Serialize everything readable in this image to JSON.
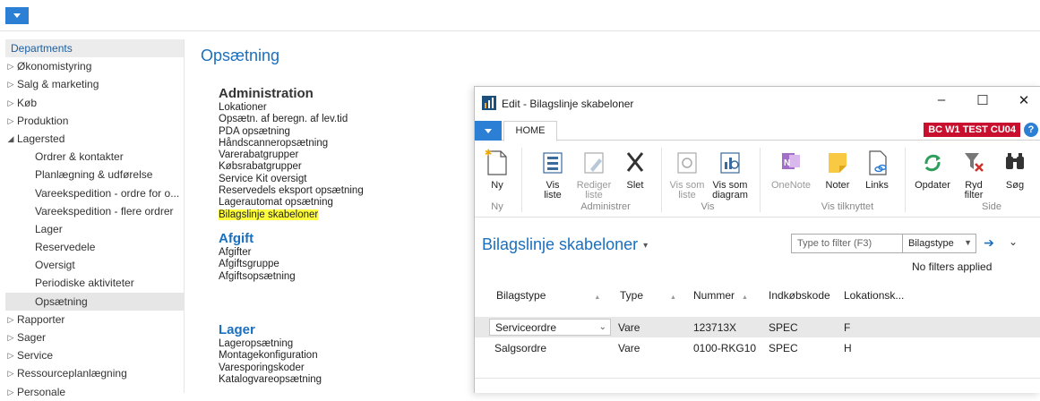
{
  "nav": {
    "root": "Departments",
    "items": [
      {
        "label": "Økonomistyring",
        "level": 0,
        "expanded": false
      },
      {
        "label": "Salg & marketing",
        "level": 0,
        "expanded": false
      },
      {
        "label": "Køb",
        "level": 0,
        "expanded": false
      },
      {
        "label": "Produktion",
        "level": 0,
        "expanded": false
      },
      {
        "label": "Lagersted",
        "level": 0,
        "expanded": true
      },
      {
        "label": "Ordrer & kontakter",
        "level": 1
      },
      {
        "label": "Planlægning & udførelse",
        "level": 1
      },
      {
        "label": "Vareekspedition - ordre for o...",
        "level": 1
      },
      {
        "label": "Vareekspedition - flere ordrer",
        "level": 1
      },
      {
        "label": "Lager",
        "level": 1
      },
      {
        "label": "Reservedele",
        "level": 1
      },
      {
        "label": "Oversigt",
        "level": 1
      },
      {
        "label": "Periodiske aktiviteter",
        "level": 1
      },
      {
        "label": "Opsætning",
        "level": 1,
        "selected": true
      },
      {
        "label": "Rapporter",
        "level": 0,
        "expanded": false
      },
      {
        "label": "Sager",
        "level": 0,
        "expanded": false
      },
      {
        "label": "Service",
        "level": 0,
        "expanded": false
      },
      {
        "label": "Ressourceplanlægning",
        "level": 0,
        "expanded": false
      },
      {
        "label": "Personale",
        "level": 0,
        "expanded": false
      }
    ]
  },
  "page": {
    "title": "Opsætning",
    "sections": [
      {
        "heading": "Administration",
        "style": "admin",
        "links": [
          "Lokationer",
          "Opsætn. af beregn. af lev.tid",
          "PDA opsætning",
          "Håndscanneropsætning",
          "Varerabatgrupper",
          "Købsrabatgrupper",
          "Service Kit oversigt",
          "Reservedels eksport opsætning",
          "Lagerautomat opsætning",
          "Bilagslinje skabeloner"
        ],
        "highlighted": "Bilagslinje skabeloner"
      },
      {
        "heading": "Afgift",
        "style": "blue",
        "links": [
          "Afgifter",
          "Afgiftsgruppe",
          "Afgiftsopsætning"
        ]
      },
      {
        "heading": "Lager",
        "style": "blue",
        "links": [
          "Lageropsætning",
          "Montagekonfiguration",
          "Varesporingskoder",
          "Katalogvareopsætning"
        ]
      }
    ]
  },
  "window": {
    "title": "Edit - Bilagslinje skabeloner",
    "tab": "HOME",
    "env_badge": "BC W1 TEST CU04",
    "help": "?",
    "ribbon": {
      "buttons": {
        "new": "Ny",
        "view_list_1": "Vis",
        "view_list_2": "liste",
        "edit_list_1": "Rediger",
        "edit_list_2": "liste",
        "delete": "Slet",
        "show_as_list_1": "Vis som",
        "show_as_list_2": "liste",
        "show_as_chart_1": "Vis som",
        "show_as_chart_2": "diagram",
        "onenote": "OneNote",
        "notes": "Noter",
        "links": "Links",
        "refresh": "Opdater",
        "clear_filter_1": "Ryd",
        "clear_filter_2": "filter",
        "search": "Søg"
      },
      "groups": {
        "new": "Ny",
        "manage": "Administrer",
        "view": "Vis",
        "attached": "Vis tilknyttet",
        "page": "Side"
      }
    },
    "list": {
      "title": "Bilagslinje skabeloner",
      "filter_placeholder": "Type to filter (F3)",
      "filter_field": "Bilagstype",
      "filter_status": "No filters applied",
      "columns": [
        "Bilagstype",
        "Type",
        "Nummer",
        "Indkøbskode",
        "Lokationsk..."
      ],
      "rows": [
        {
          "bilagstype": "Serviceordre",
          "type": "Vare",
          "nummer": "123713X",
          "indkobskode": "SPEC",
          "lokation": "F"
        },
        {
          "bilagstype": "Salgsordre",
          "type": "Vare",
          "nummer": "0100-RKG10",
          "indkobskode": "SPEC",
          "lokation": "H"
        }
      ]
    }
  },
  "colors": {
    "accent": "#2b7fd4",
    "link_heading": "#1a6fbf",
    "badge": "#c8102e",
    "highlight": "#ffff3b"
  }
}
